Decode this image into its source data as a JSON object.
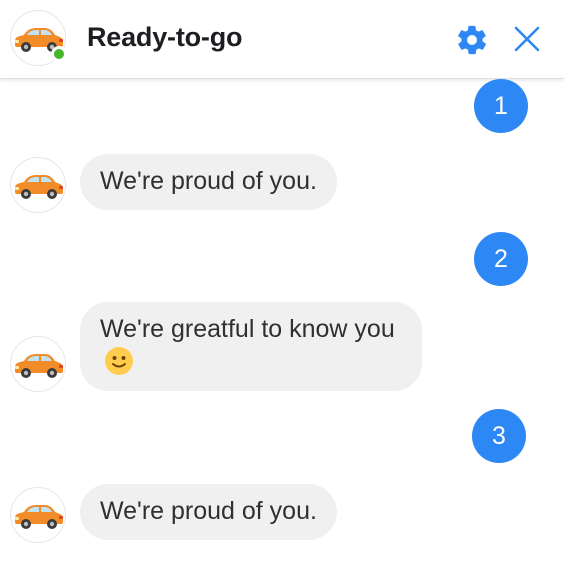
{
  "header": {
    "title": "Ready-to-go",
    "avatar_icon": "car-icon",
    "status": "online",
    "settings_icon": "gear-icon",
    "close_icon": "close-icon",
    "accent": "#2d88f5"
  },
  "messages": [
    {
      "type": "user-number",
      "text": "1"
    },
    {
      "type": "bot",
      "text": "We're proud of you."
    },
    {
      "type": "user-number",
      "text": "2"
    },
    {
      "type": "bot",
      "text": "We're greatful to know you",
      "emoji": "slightly-smiling-face"
    },
    {
      "type": "user-number",
      "text": "3"
    },
    {
      "type": "bot",
      "text": "We're proud of you."
    }
  ],
  "colors": {
    "bubble_bg": "#f0f0f0",
    "number_bg": "#2d88f5",
    "online": "#42b72a",
    "car": "#f28c28"
  }
}
